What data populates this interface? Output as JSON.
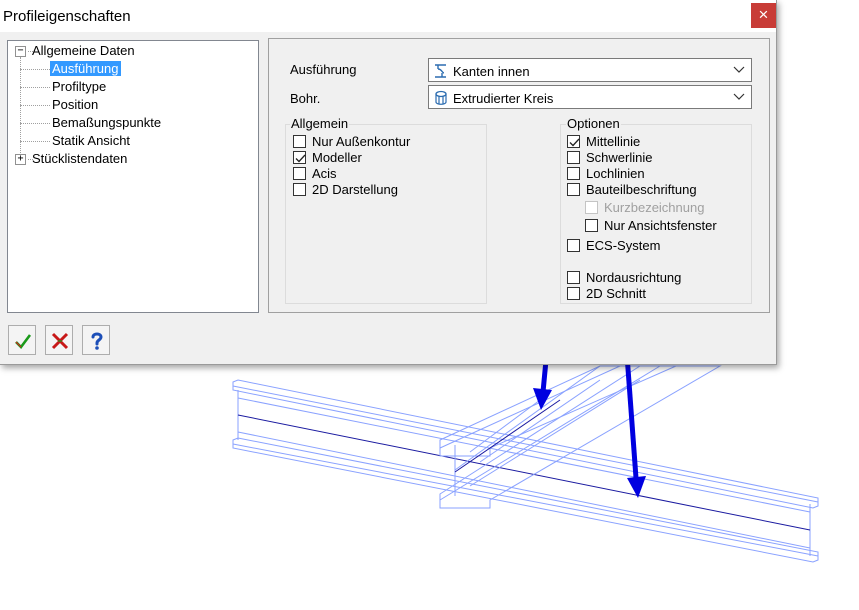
{
  "window": {
    "title": "Profileigenschaften",
    "close_glyph": "×"
  },
  "tree": {
    "items": [
      {
        "label": "Allgemeine Daten",
        "level": 0,
        "expanded": true,
        "selected": false
      },
      {
        "label": "Ausführung",
        "level": 1,
        "selected": true
      },
      {
        "label": "Profiltype",
        "level": 1,
        "selected": false
      },
      {
        "label": "Position",
        "level": 1,
        "selected": false
      },
      {
        "label": "Bemaßungspunkte",
        "level": 1,
        "selected": false
      },
      {
        "label": "Statik Ansicht",
        "level": 1,
        "selected": false
      },
      {
        "label": "Stücklistendaten",
        "level": 0,
        "expanded": false,
        "selected": false
      }
    ]
  },
  "form": {
    "ausfuehrung_label": "Ausführung",
    "ausfuehrung_value": "Kanten innen",
    "bohr_label": "Bohr.",
    "bohr_value": "Extrudierter Kreis"
  },
  "allgemein": {
    "title": "Allgemein",
    "options": [
      {
        "label": "Nur Außenkontur",
        "checked": false
      },
      {
        "label": "Modeller",
        "checked": true
      },
      {
        "label": "Acis",
        "checked": false
      },
      {
        "label": "2D Darstellung",
        "checked": false
      }
    ]
  },
  "optionen": {
    "title": "Optionen",
    "options": [
      {
        "label": "Mittellinie",
        "checked": true,
        "disabled": false
      },
      {
        "label": "Schwerlinie",
        "checked": false,
        "disabled": false
      },
      {
        "label": "Lochlinien",
        "checked": false,
        "disabled": false
      },
      {
        "label": "Bauteilbeschriftung",
        "checked": false,
        "disabled": false
      },
      {
        "label": "Kurzbezeichnung",
        "checked": false,
        "disabled": true
      },
      {
        "label": "Nur Ansichtsfenster",
        "checked": false,
        "disabled": false
      },
      {
        "label": "ECS-System",
        "checked": false,
        "disabled": false
      },
      {
        "label": "Nordausrichtung",
        "checked": false,
        "disabled": false
      },
      {
        "label": "2D Schnitt",
        "checked": false,
        "disabled": false
      }
    ]
  },
  "toolbar": {
    "ok_icon": "checkmark-icon",
    "cancel_icon": "cancel-x-icon",
    "help_icon": "question-icon"
  },
  "colors": {
    "accent": "#3399ff",
    "beam": "#6f8cff",
    "arrow": "#0000e0",
    "close": "#c83c37"
  }
}
